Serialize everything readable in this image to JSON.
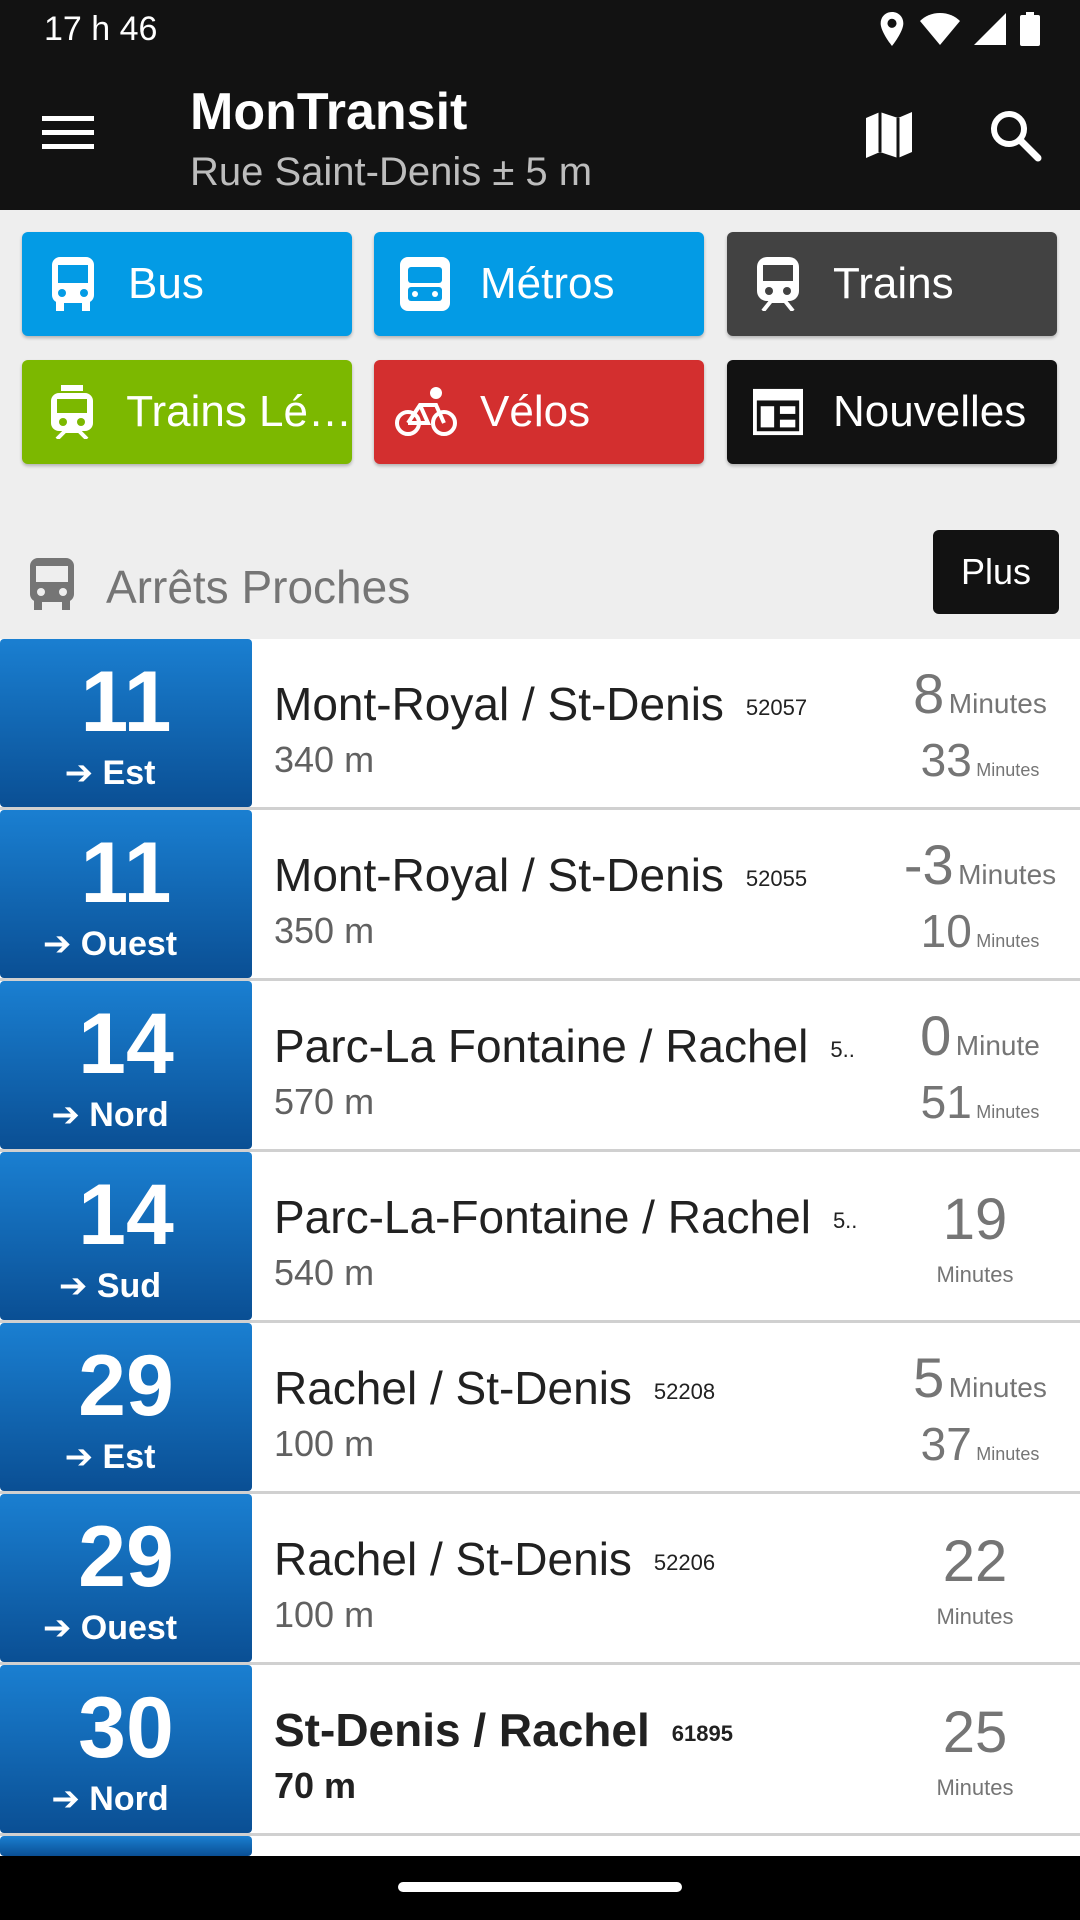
{
  "status_bar": {
    "time": "17 h 46",
    "icons": [
      "location-icon",
      "wifi-icon",
      "signal-icon",
      "battery-icon"
    ]
  },
  "app_bar": {
    "title": "MonTransit",
    "subtitle": "Rue Saint-Denis ± 5 m"
  },
  "modes": [
    {
      "label": "Bus",
      "icon": "bus-icon",
      "color": "#039be5"
    },
    {
      "label": "Métros",
      "icon": "subway-icon",
      "color": "#039be5"
    },
    {
      "label": "Trains",
      "icon": "train-icon",
      "color": "#424242"
    },
    {
      "label": "Trains Lé…",
      "icon": "light-rail-icon",
      "color": "#7cb800"
    },
    {
      "label": "Vélos",
      "icon": "bike-icon",
      "color": "#d32f2f"
    },
    {
      "label": "Nouvelles",
      "icon": "news-icon",
      "color": "#121212"
    }
  ],
  "nearby": {
    "title": "Arrêts Proches",
    "more_label": "Plus",
    "stops": [
      {
        "route": "11",
        "direction": "➔ Est",
        "name": "Mont-Royal / St-Denis",
        "code": "52057",
        "distance": "340 m",
        "t1": "8",
        "t1_unit": "Minutes",
        "t2": "33",
        "t2_unit": "Minutes"
      },
      {
        "route": "11",
        "direction": "➔ Ouest",
        "name": "Mont-Royal / St-Denis",
        "code": "52055",
        "distance": "350 m",
        "t1": "-3",
        "t1_unit": "Minutes",
        "t2": "10",
        "t2_unit": "Minutes"
      },
      {
        "route": "14",
        "direction": "➔ Nord",
        "name": "Parc-La Fontaine / Rachel",
        "code": "5..",
        "distance": "570 m",
        "t1": "0",
        "t1_unit": "Minute",
        "t2": "51",
        "t2_unit": "Minutes"
      },
      {
        "route": "14",
        "direction": "➔ Sud",
        "name": "Parc-La-Fontaine / Rachel",
        "code": "5..",
        "distance": "540 m",
        "t1": "19",
        "t1_unit": "Minutes"
      },
      {
        "route": "29",
        "direction": "➔ Est",
        "name": "Rachel / St-Denis",
        "code": "52208",
        "distance": "100 m",
        "t1": "5",
        "t1_unit": "Minutes",
        "t2": "37",
        "t2_unit": "Minutes"
      },
      {
        "route": "29",
        "direction": "➔ Ouest",
        "name": "Rachel / St-Denis",
        "code": "52206",
        "distance": "100 m",
        "t1": "22",
        "t1_unit": "Minutes"
      },
      {
        "route": "30",
        "direction": "➔ Nord",
        "name": "St-Denis / Rachel",
        "code": "61895",
        "distance": "70 m",
        "t1": "25",
        "t1_unit": "Minutes"
      }
    ]
  }
}
